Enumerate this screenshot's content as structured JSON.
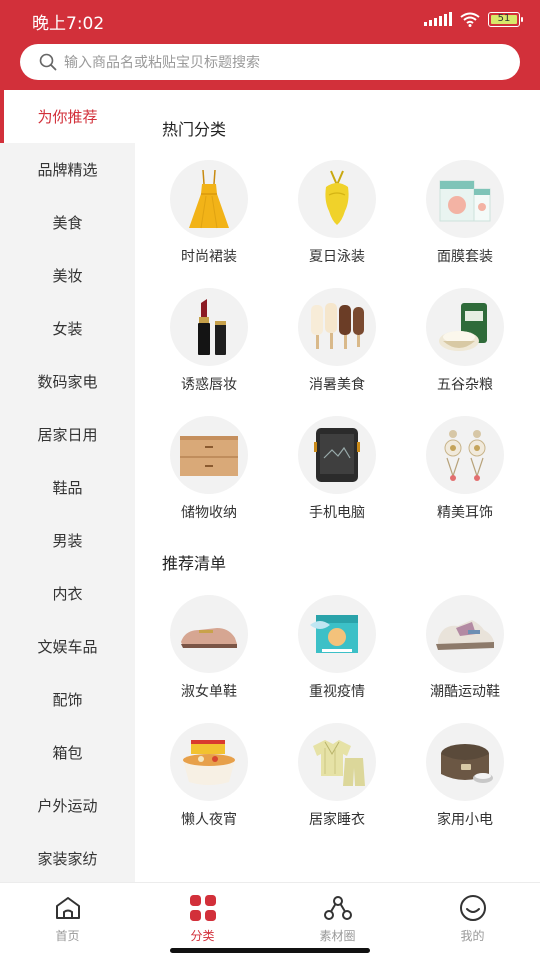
{
  "status_bar": {
    "time": "晚上7:02",
    "battery": "51"
  },
  "search": {
    "placeholder": "输入商品名或粘贴宝贝标题搜索"
  },
  "sidebar": {
    "items": [
      {
        "label": "为你推荐",
        "active": true
      },
      {
        "label": "品牌精选"
      },
      {
        "label": "美食"
      },
      {
        "label": "美妆"
      },
      {
        "label": "女装"
      },
      {
        "label": "数码家电"
      },
      {
        "label": "居家日用"
      },
      {
        "label": "鞋品"
      },
      {
        "label": "男装"
      },
      {
        "label": "内衣"
      },
      {
        "label": "文娱车品"
      },
      {
        "label": "配饰"
      },
      {
        "label": "箱包"
      },
      {
        "label": "户外运动"
      },
      {
        "label": "家装家纺"
      }
    ]
  },
  "hot_categories": {
    "title": "热门分类",
    "items": [
      {
        "label": "时尚裙装",
        "icon": "dress-icon"
      },
      {
        "label": "夏日泳装",
        "icon": "swimsuit-icon"
      },
      {
        "label": "面膜套装",
        "icon": "facemask-box-icon"
      },
      {
        "label": "诱惑唇妆",
        "icon": "lipstick-icon"
      },
      {
        "label": "消暑美食",
        "icon": "popsicle-icon"
      },
      {
        "label": "五谷杂粮",
        "icon": "rice-bag-icon"
      },
      {
        "label": "储物收纳",
        "icon": "drawer-icon"
      },
      {
        "label": "手机电脑",
        "icon": "rugged-phone-icon"
      },
      {
        "label": "精美耳饰",
        "icon": "earrings-icon"
      }
    ]
  },
  "recommend_list": {
    "title": "推荐清单",
    "items": [
      {
        "label": "淑女单鞋",
        "icon": "loafer-icon"
      },
      {
        "label": "重视疫情",
        "icon": "mask-box-icon"
      },
      {
        "label": "潮酷运动鞋",
        "icon": "sneaker-icon"
      },
      {
        "label": "懒人夜宵",
        "icon": "instant-noodles-icon"
      },
      {
        "label": "居家睡衣",
        "icon": "pajamas-icon"
      },
      {
        "label": "家用小电",
        "icon": "rice-cooker-icon"
      }
    ]
  },
  "tabbar": {
    "items": [
      {
        "label": "首页",
        "icon": "home-icon"
      },
      {
        "label": "分类",
        "icon": "category-icon",
        "active": true
      },
      {
        "label": "素材圈",
        "icon": "circle-nodes-icon"
      },
      {
        "label": "我的",
        "icon": "profile-smile-icon"
      }
    ]
  },
  "colors": {
    "brand": "#d2303a",
    "sidebar_bg": "#f3f3f3",
    "thumb_bg": "#f2f2f2"
  }
}
